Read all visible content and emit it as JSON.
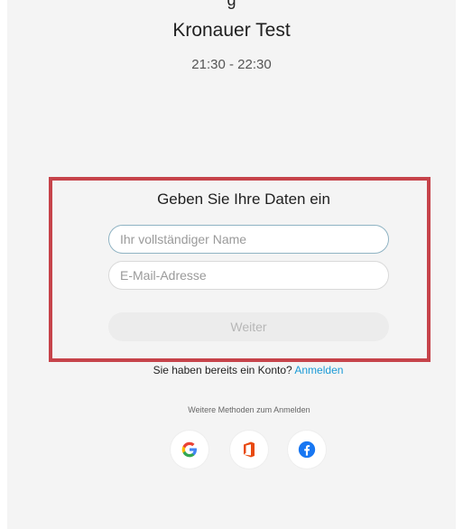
{
  "header": {
    "top_cut_text": "g",
    "event_title": "Kronauer Test",
    "event_time": "21:30 - 22:30"
  },
  "form": {
    "heading": "Geben Sie Ihre Daten ein",
    "name_placeholder": "Ihr vollständiger Name",
    "email_placeholder": "E-Mail-Adresse",
    "continue_label": "Weiter"
  },
  "account": {
    "prompt": "Sie haben bereits ein Konto?",
    "signin_link": "Anmelden"
  },
  "other_methods": {
    "label": "Weitere Methoden zum Anmelden",
    "providers": [
      {
        "name": "google",
        "icon": "google-icon"
      },
      {
        "name": "office",
        "icon": "office-icon"
      },
      {
        "name": "facebook",
        "icon": "facebook-icon"
      }
    ]
  },
  "colors": {
    "highlight": "#c6434a",
    "link": "#1a9ad6",
    "facebook": "#1877f2",
    "office": "#e8490f"
  }
}
